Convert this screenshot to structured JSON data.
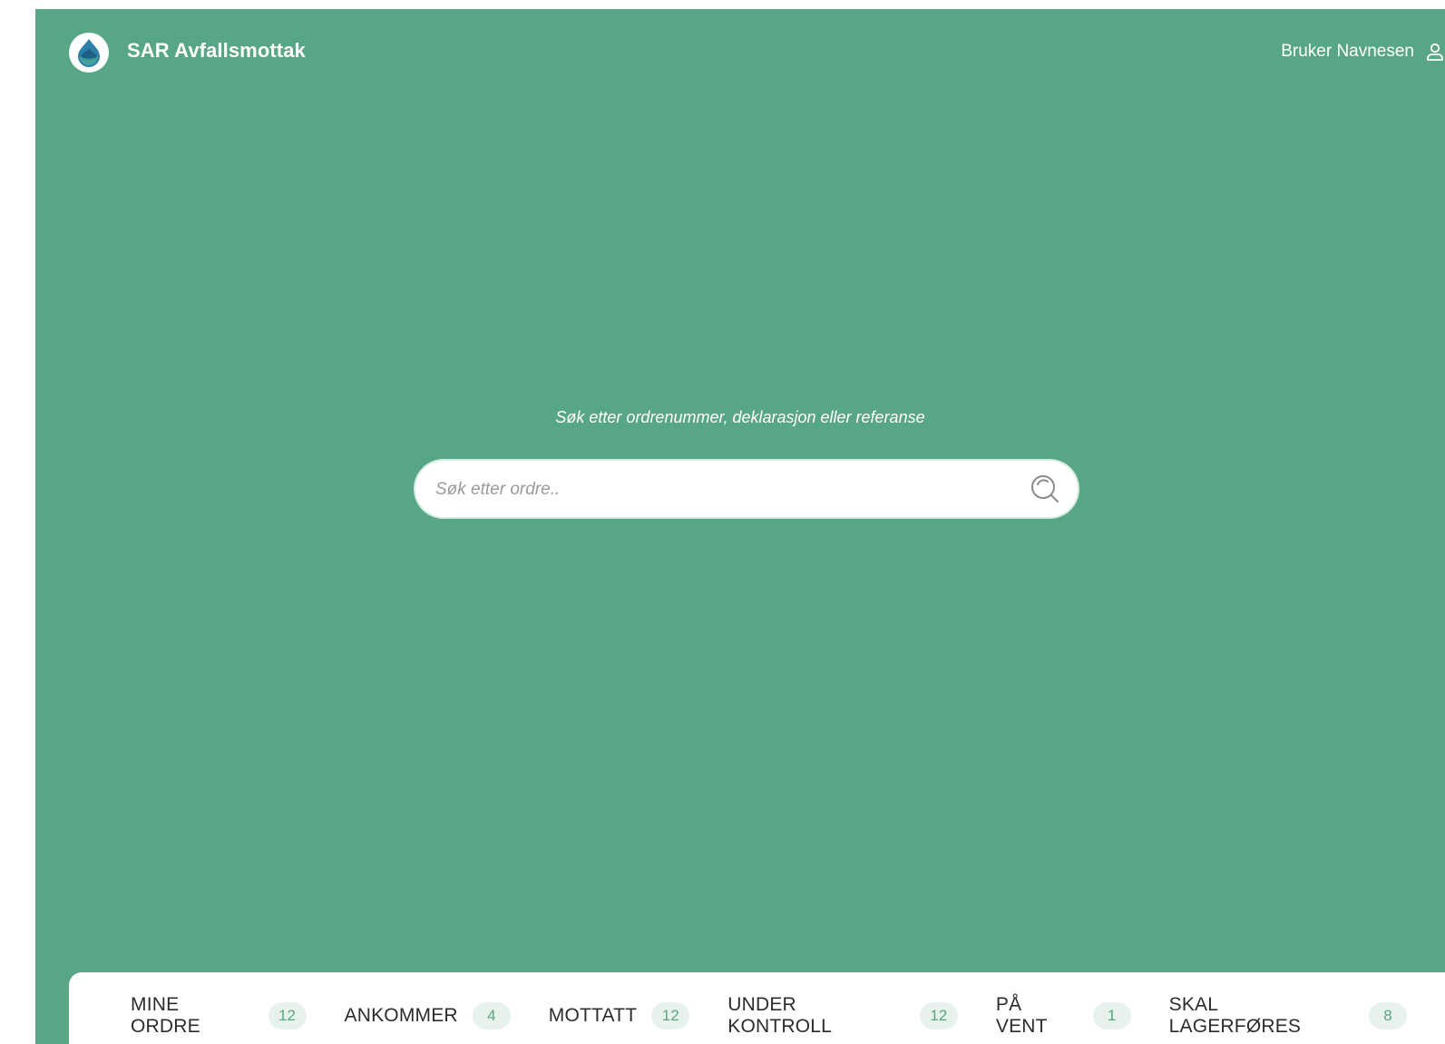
{
  "header": {
    "app_title": "SAR Avfallsmottak",
    "user_name": "Bruker Navnesen",
    "logo_icon": "water-drop-icon",
    "user_icon": "user-icon"
  },
  "search": {
    "hint": "Søk etter ordrenummer, deklarasjon eller referanse",
    "placeholder": "Søk etter ordre..",
    "value": "",
    "icon": "search-icon"
  },
  "tabs": [
    {
      "label": "MINE ORDRE",
      "count": "12"
    },
    {
      "label": "ANKOMMER",
      "count": "4"
    },
    {
      "label": "MOTTATT",
      "count": "12"
    },
    {
      "label": "UNDER KONTROLL",
      "count": "12"
    },
    {
      "label": "PÅ VENT",
      "count": "1"
    },
    {
      "label": "SKAL LAGERFØRES",
      "count": "8"
    }
  ],
  "colors": {
    "brand_green": "#57a686",
    "badge_bg": "#e8f2ec",
    "logo_blue": "#2c7fa8"
  }
}
